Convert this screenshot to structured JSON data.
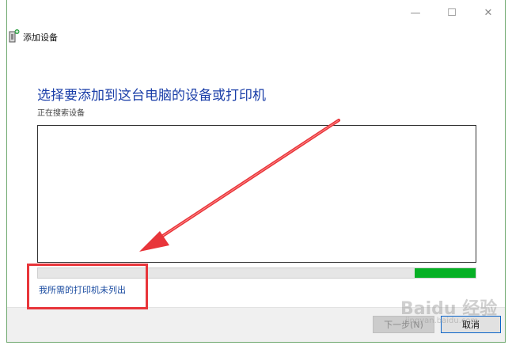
{
  "window": {
    "title": "添加设备",
    "controls": {
      "minimize": "—",
      "maximize": "☐",
      "close": "✕"
    }
  },
  "main": {
    "heading": "选择要添加到这台电脑的设备或打印机",
    "status": "正在搜索设备",
    "progress": 0.14,
    "printer_link": "我所需的打印机未列出"
  },
  "footer": {
    "next_label": "下一步(N)",
    "cancel_label": "取消"
  },
  "watermark": {
    "brand": "Baidu 经验",
    "url": "jingyan.baidu.com"
  },
  "colors": {
    "heading": "#1a3ea8",
    "link": "#1a4ba0",
    "progress": "#06b025",
    "annotation": "#e8353a"
  }
}
